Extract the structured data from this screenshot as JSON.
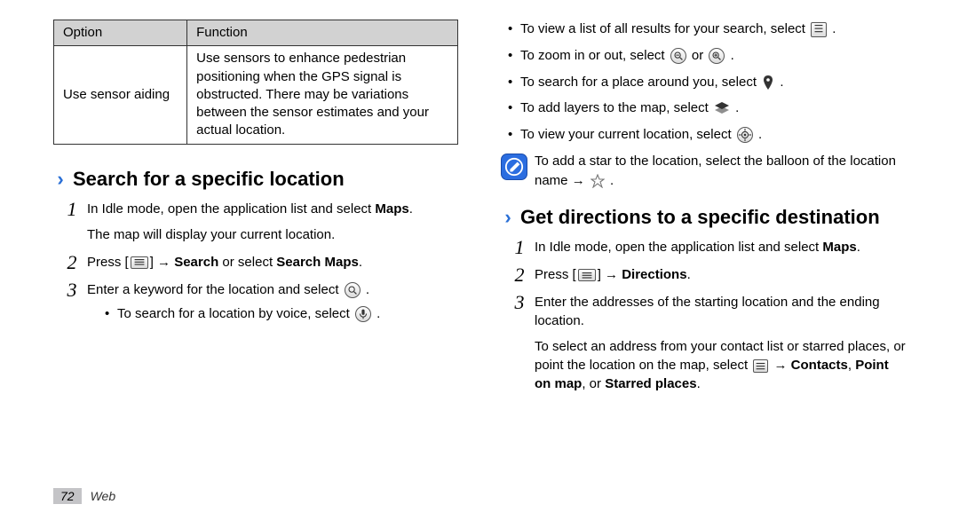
{
  "table": {
    "headers": {
      "option": "Option",
      "function": "Function"
    },
    "rows": [
      {
        "option": "Use sensor aiding",
        "function": "Use sensors to enhance pedestrian positioning when the GPS signal is obstructed. There may be variations between the sensor estimates and your actual location."
      }
    ]
  },
  "left": {
    "heading": "Search for a specific location",
    "step1_a": "In Idle mode, open the application list and select ",
    "step1_b": "Maps",
    "step1_c": ".",
    "step1_sub": "The map will display your current location.",
    "step2_a": "Press [",
    "step2_b": "] → ",
    "step2_c": "Search",
    "step2_d": " or select ",
    "step2_e": "Search Maps",
    "step2_f": ".",
    "step3": "Enter a keyword for the location and select ",
    "step3_bullet": "To search for a location by voice, select "
  },
  "right": {
    "bullets": {
      "b1": "To view a list of all results for your search, select ",
      "b2": "To zoom in or out, select ",
      "b2_or": " or ",
      "b3": "To search for a place around you, select ",
      "b4": "To add layers to the map, select ",
      "b5": "To view your current location, select "
    },
    "note": "To add a star to the location, select the balloon of the location name → ",
    "heading": "Get directions to a specific destination",
    "step1_a": "In Idle mode, open the application list and select ",
    "step1_b": "Maps",
    "step1_c": ".",
    "step2_a": "Press [",
    "step2_b": "] → ",
    "step2_c": "Directions",
    "step2_d": ".",
    "step3": "Enter the addresses of the starting location and the ending location.",
    "step3_sub_a": "To select an address from your contact list or starred places, or point the location on the map, select ",
    "step3_sub_b": " → ",
    "step3_sub_c": "Contacts",
    "step3_sub_d": ", ",
    "step3_sub_e": "Point on map",
    "step3_sub_f": ", or ",
    "step3_sub_g": "Starred places",
    "step3_sub_h": "."
  },
  "footer": {
    "page": "72",
    "section": "Web"
  }
}
